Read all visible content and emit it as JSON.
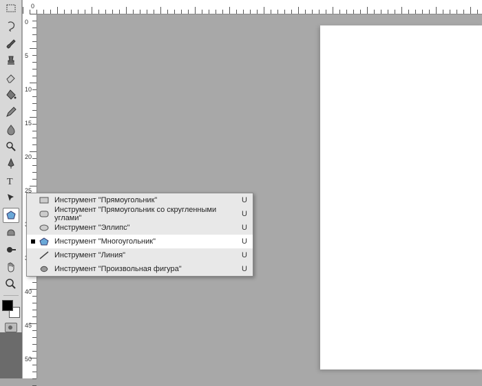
{
  "toolbar": {
    "tools": [
      {
        "name": "marquee",
        "active": false
      },
      {
        "name": "lasso",
        "active": false
      },
      {
        "name": "brush",
        "active": false
      },
      {
        "name": "stamp",
        "active": false
      },
      {
        "name": "eraser",
        "active": false
      },
      {
        "name": "bucket",
        "active": false
      },
      {
        "name": "pencil",
        "active": false
      },
      {
        "name": "blur",
        "active": false
      },
      {
        "name": "magnify",
        "active": false
      },
      {
        "name": "pen",
        "active": false
      },
      {
        "name": "type",
        "active": false
      },
      {
        "name": "path-select",
        "active": false
      },
      {
        "name": "shape",
        "active": true
      },
      {
        "name": "sponge",
        "active": false
      },
      {
        "name": "dodge",
        "active": false
      },
      {
        "name": "hand",
        "active": false
      },
      {
        "name": "zoom",
        "active": false
      }
    ]
  },
  "ruler": {
    "h": [
      "0"
    ],
    "v": [
      "0",
      "5",
      "1\n0",
      "1\n5",
      "2\n0",
      "2\n5",
      "3\n0",
      "3\n5",
      "4\n0",
      "4\n5",
      "5\n0"
    ]
  },
  "flyout": {
    "items": [
      {
        "icon": "rect",
        "label": "Инструмент \"Прямоугольник\"",
        "key": "U",
        "selected": false
      },
      {
        "icon": "roundrect",
        "label": "Инструмент \"Прямоугольник со скругленными углами\"",
        "key": "U",
        "selected": false
      },
      {
        "icon": "ellipse",
        "label": "Инструмент \"Эллипс\"",
        "key": "U",
        "selected": false
      },
      {
        "icon": "polygon",
        "label": "Инструмент \"Многоугольник\"",
        "key": "U",
        "selected": true
      },
      {
        "icon": "line",
        "label": "Инструмент \"Линия\"",
        "key": "U",
        "selected": false
      },
      {
        "icon": "custom",
        "label": "Инструмент \"Произвольная фигура\"",
        "key": "U",
        "selected": false
      }
    ]
  }
}
